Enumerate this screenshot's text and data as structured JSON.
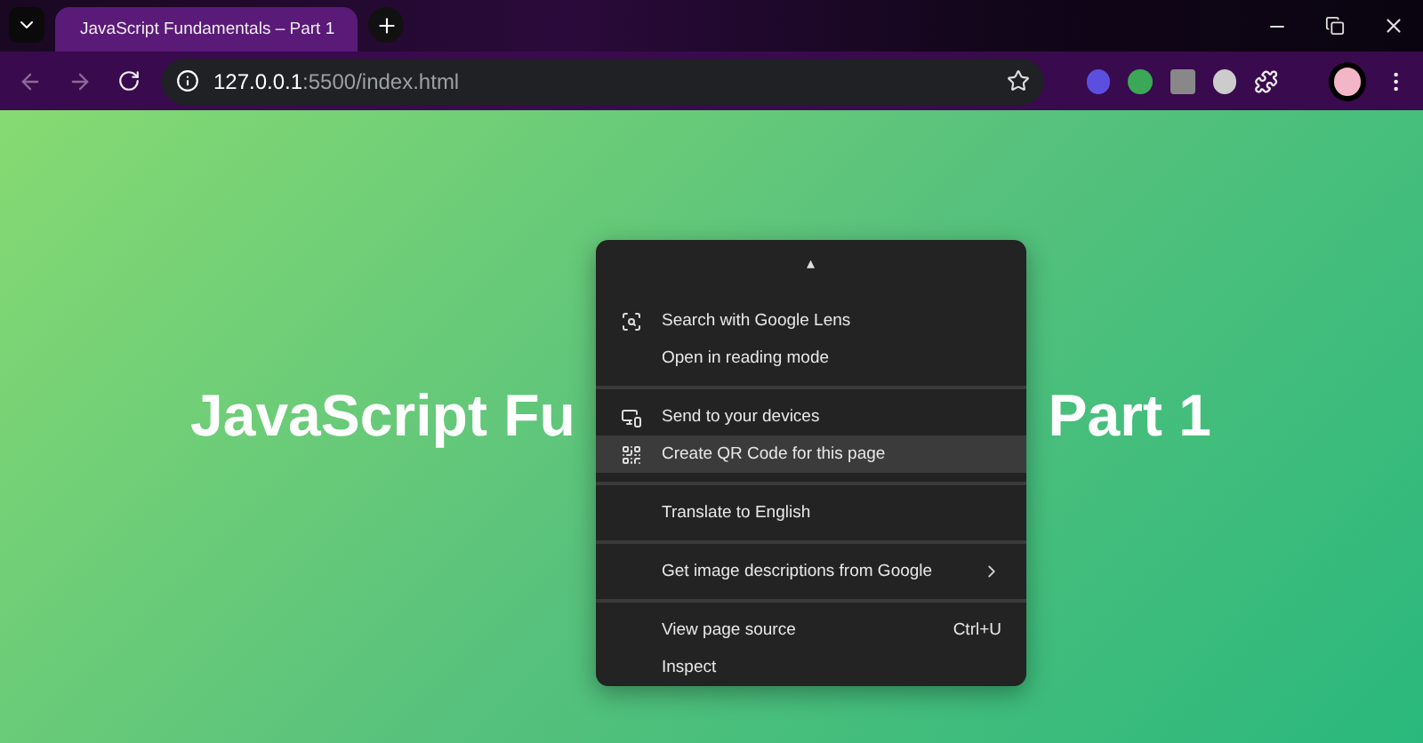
{
  "tab_strip": {
    "tabs": [
      {
        "title": "JavaScript Fundamentals – Part 1",
        "selected": true
      }
    ]
  },
  "toolbar": {
    "address": {
      "host": "127.0.0.1",
      "rest": ":5500/index.html"
    }
  },
  "page": {
    "heading_visible_left": "JavaScript Fu",
    "heading_visible_right": "Part 1"
  },
  "context_menu": {
    "scroll_indicator": "▴",
    "groups": [
      [
        {
          "kind": "lens",
          "label": "Search with Google Lens",
          "selected": false
        },
        {
          "kind": "plain",
          "label": "Open in reading mode",
          "selected": false
        }
      ],
      [
        {
          "kind": "devices",
          "label": "Send to your devices",
          "selected": false
        },
        {
          "kind": "qr",
          "label": "Create QR Code for this page",
          "selected": true
        }
      ],
      [
        {
          "kind": "plain",
          "label": "Translate to English",
          "selected": false
        }
      ],
      [
        {
          "kind": "plain",
          "label": "Get image descriptions from Google",
          "selected": false,
          "submenu": true
        }
      ],
      [
        {
          "kind": "plain",
          "label": "View page source",
          "selected": false,
          "shortcut": "Ctrl+U"
        },
        {
          "kind": "plain",
          "label": "Inspect",
          "selected": false
        }
      ]
    ]
  }
}
